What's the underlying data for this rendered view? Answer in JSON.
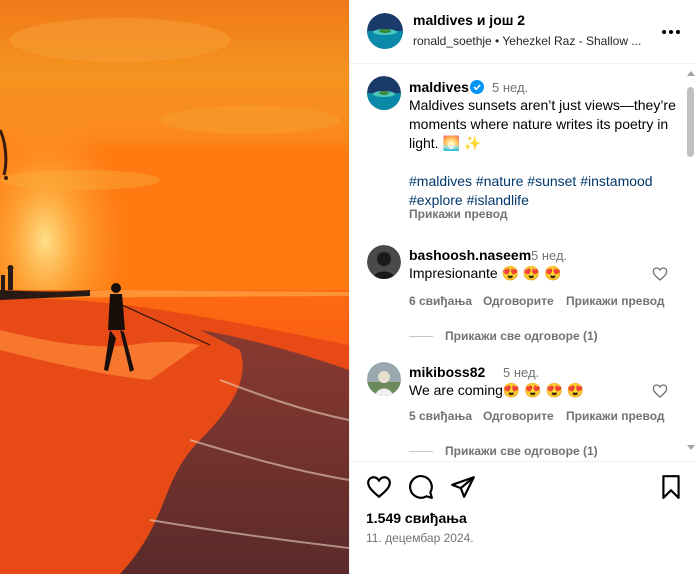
{
  "header": {
    "title": "maldives и још 2",
    "subtitle": "ronald_soethje • Yehezkel Raz - Shallow ..."
  },
  "caption": {
    "username": "maldives",
    "time": "5 нед.",
    "text": "Maldives sunsets aren’t just views—they’re moments where nature writes its poetry in light. 🌅 ✨",
    "hashtags": "#maldives #nature #sunset #instamood #explore #islandlife",
    "translate": "Прикажи превод"
  },
  "comments": [
    {
      "username": "bashoosh.naseem",
      "time": "5 нед.",
      "text": "Impresionante 😍 😍 😍",
      "likes": "6 свиђања",
      "reply": "Одговорите",
      "translate": "Прикажи превод",
      "view_replies": "Прикажи све одговоре (1)"
    },
    {
      "username": "mikiboss82",
      "time": "5 нед.",
      "text": "We are coming😍 😍 😍 😍",
      "likes": "5 свиђања",
      "reply": "Одговорите",
      "translate": "Прикажи превод",
      "view_replies": "Прикажи све одговоре (1)"
    }
  ],
  "footer": {
    "likes": "1.549 свиђања",
    "date": "11. децембар 2024."
  },
  "colors": {
    "accent_verified": "#0095f6",
    "link": "#00376b",
    "secondary_text": "#737373"
  },
  "icons": [
    "more-icon",
    "verified-icon",
    "heart-icon",
    "comment-icon",
    "share-icon",
    "bookmark-icon"
  ]
}
